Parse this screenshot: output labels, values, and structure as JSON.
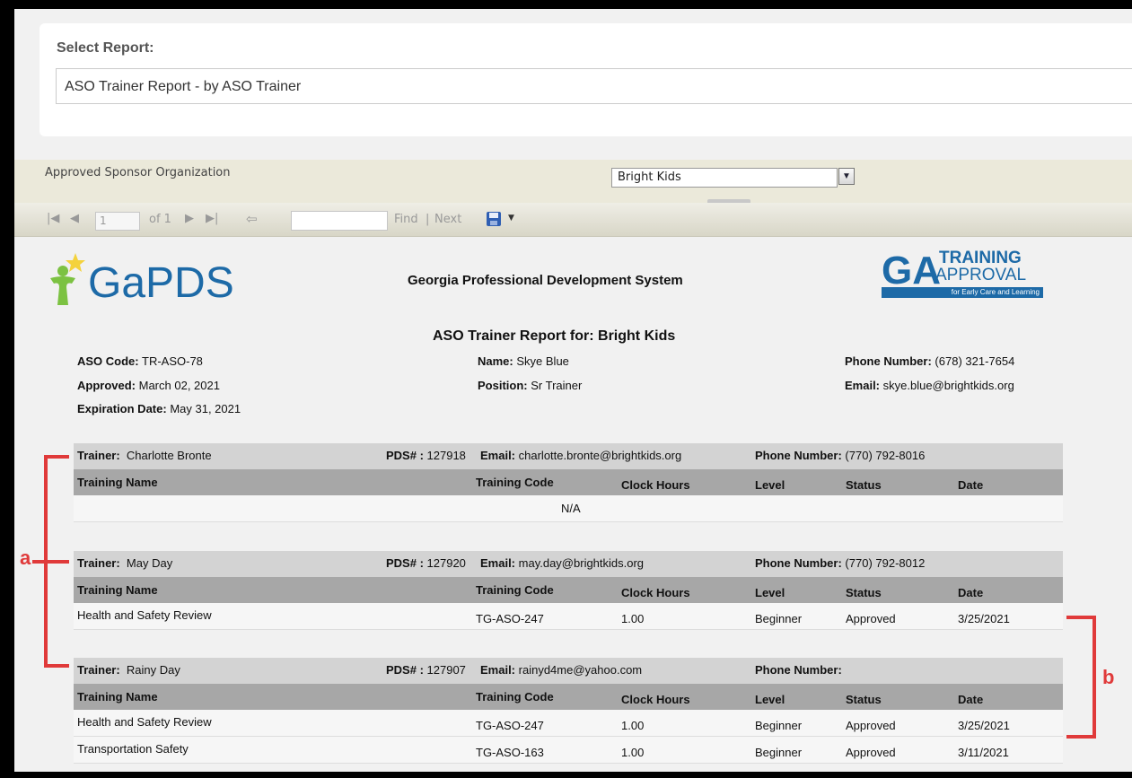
{
  "select_report": {
    "label": "Select Report:",
    "value": "ASO Trainer Report - by ASO Trainer"
  },
  "params": {
    "label": "Approved Sponsor Organization",
    "org_value": "Bright Kids"
  },
  "toolbar": {
    "page_value": "1",
    "page_of": "of 1",
    "find_label": "Find",
    "separator": "|",
    "next_label": "Next"
  },
  "report": {
    "logo_left_text": "GaPDS",
    "title": "Georgia Professional Development System",
    "logo_right": {
      "big": "GA",
      "line1": "TRAINING",
      "line2": "APPROVAL",
      "line3": "for Early Care and Learning"
    },
    "subtitle": "ASO Trainer Report for:  Bright Kids",
    "aso": {
      "code_label": "ASO Code:",
      "code": "TR-ASO-78",
      "approved_label": "Approved:",
      "approved": "March 02, 2021",
      "expiration_label": "Expiration Date:",
      "expiration": "May 31, 2021",
      "name_label": "Name:",
      "name": "Skye Blue",
      "position_label": "Position:",
      "position": "Sr Trainer",
      "phone_label": "Phone Number:",
      "phone": "(678) 321-7654",
      "email_label": "Email:",
      "email": "skye.blue@brightkids.org"
    },
    "columns": [
      "Training Name",
      "Training Code",
      "Clock Hours",
      "Level",
      "Status",
      "Date"
    ],
    "trainer_label": "Trainer:",
    "pds_label": "PDS# :",
    "email_label": "Email:",
    "phone_label": "Phone Number:",
    "na": "N/A",
    "trainers": [
      {
        "name": "Charlotte Bronte",
        "pds": "127918",
        "email": "charlotte.bronte@brightkids.org",
        "phone": "(770) 792-8016",
        "rows": []
      },
      {
        "name": "May Day",
        "pds": "127920",
        "email": "may.day@brightkids.org",
        "phone": "(770) 792-8012",
        "rows": [
          {
            "name": "Health and Safety Review",
            "code": "TG-ASO-247",
            "hours": "1.00",
            "level": "Beginner",
            "status": "Approved",
            "date": "3/25/2021"
          }
        ]
      },
      {
        "name": "Rainy Day",
        "pds": "127907",
        "email": "rainyd4me@yahoo.com",
        "phone": "",
        "rows": [
          {
            "name": "Health and Safety Review",
            "code": "TG-ASO-247",
            "hours": "1.00",
            "level": "Beginner",
            "status": "Approved",
            "date": "3/25/2021"
          },
          {
            "name": "Transportation Safety",
            "code": "TG-ASO-163",
            "hours": "1.00",
            "level": "Beginner",
            "status": "Approved",
            "date": "3/11/2021"
          }
        ]
      }
    ]
  },
  "annotations": {
    "a": "a",
    "b": "b"
  },
  "colors": {
    "accent_red": "#e03a3a",
    "logo_blue": "#1d6aa7",
    "logo_green": "#7cc242"
  }
}
